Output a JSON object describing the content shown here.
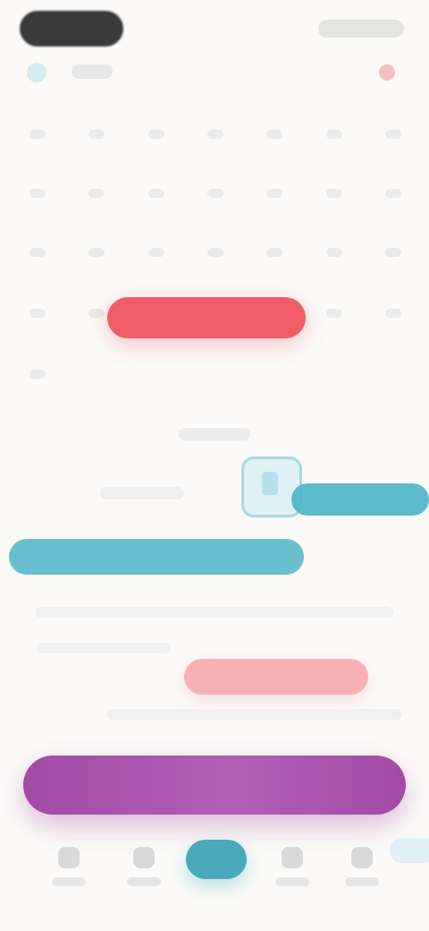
{
  "status_bar": {
    "time": "",
    "network": ""
  },
  "header": {
    "title": "",
    "back_icon": "back-icon",
    "alert_icon": "alert-icon"
  },
  "calendar": {
    "weeks": [
      [
        "",
        "",
        "",
        "",
        "",
        "",
        ""
      ],
      [
        "",
        "",
        "",
        "",
        "",
        "",
        ""
      ],
      [
        "",
        "",
        "",
        "",
        "",
        "",
        ""
      ],
      [
        "",
        "",
        "",
        "",
        "",
        "",
        ""
      ],
      [
        "",
        "",
        "",
        "",
        "",
        "",
        ""
      ]
    ]
  },
  "highlight": {
    "label": ""
  },
  "cta": {
    "label": ""
  },
  "bottom_nav": {
    "items": [
      {
        "label": "",
        "icon": "home-icon"
      },
      {
        "label": "",
        "icon": "calendar-icon"
      },
      {
        "label": "",
        "icon": "add-icon"
      },
      {
        "label": "",
        "icon": "chart-icon"
      },
      {
        "label": "",
        "icon": "profile-icon"
      }
    ]
  },
  "colors": {
    "accent_pink": "#ef5e67",
    "accent_cyan": "#4bb4c6",
    "accent_purple": "#a34aa5"
  }
}
